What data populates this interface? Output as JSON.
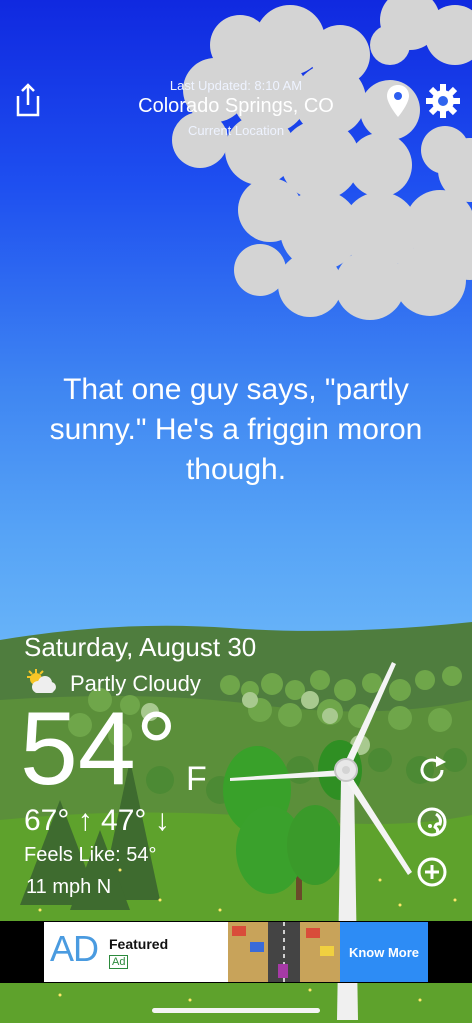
{
  "header": {
    "last_updated": "Last Updated: 8:10 AM",
    "city": "Colorado Springs, CO",
    "current_location": "Current Location"
  },
  "quote": "That one guy says, \"partly sunny.\" He's a friggin moron though.",
  "weather": {
    "date": "Saturday, August 30",
    "condition": "Partly Cloudy",
    "condition_icon": "partly-cloudy-icon",
    "temperature": "54°",
    "unit": "F",
    "high_low": "67° ↑  47° ↓",
    "feels_like": "Feels Like: 54°",
    "wind": "11 mph N"
  },
  "actions": {
    "share_icon": "share-icon",
    "location_icon": "location-pin-icon",
    "settings_icon": "gear-icon",
    "refresh_icon": "refresh-icon",
    "radar_icon": "globe-icon",
    "add_icon": "add-location-icon"
  },
  "ad": {
    "logo": "AD",
    "title": "Featured",
    "badge": "Ad",
    "button": "Know More"
  },
  "colors": {
    "sky_top": "#1029e0",
    "sky_bottom": "#6fb7f7",
    "hill": "#4d7a3f",
    "grass": "#5a9a2e",
    "ad_button": "#2d8cf5"
  }
}
